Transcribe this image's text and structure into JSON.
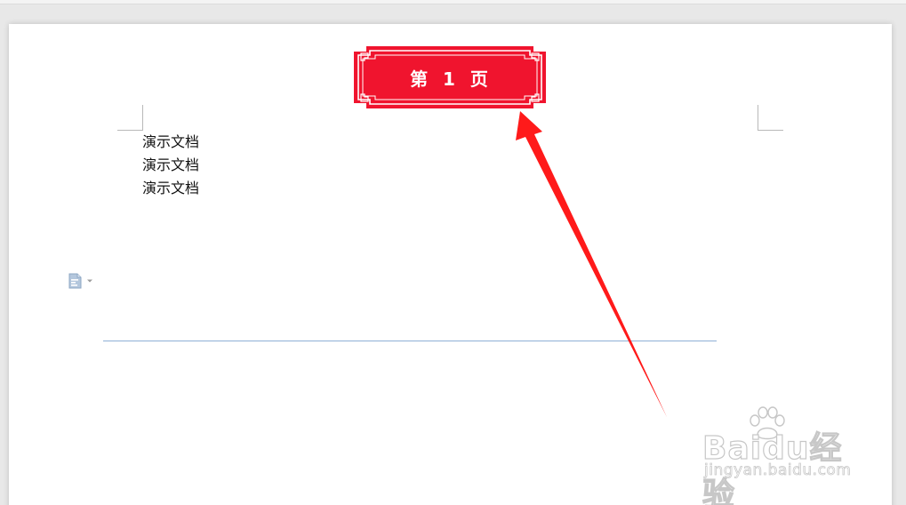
{
  "document": {
    "lines": [
      "演示文档",
      "演示文档",
      "演示文档"
    ]
  },
  "header_badge": {
    "text": "第 1 页",
    "color": "#f0142e"
  },
  "annotation": {
    "arrow_color": "#ff1a1a"
  },
  "watermark": {
    "brand": "Baidu经验",
    "url": "jingyan.baidu.com"
  },
  "icons": {
    "doc_tool": "document-format-icon",
    "dropdown": "caret-down-icon"
  }
}
